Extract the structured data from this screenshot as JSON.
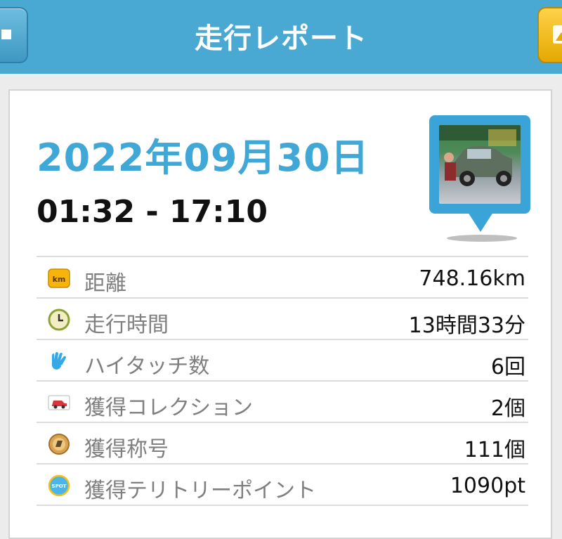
{
  "header": {
    "title": "走行レポート"
  },
  "report": {
    "date": "2022年09月30日",
    "time_range": "01:32 - 17:10"
  },
  "stats": [
    {
      "icon": "km-icon",
      "label": "距離",
      "value": "748.16km"
    },
    {
      "icon": "clock-icon",
      "label": "走行時間",
      "value": "13時間33分"
    },
    {
      "icon": "hi-hand-icon",
      "label": "ハイタッチ数",
      "value": "6回"
    },
    {
      "icon": "car-collection-icon",
      "label": "獲得コレクション",
      "value": "2個"
    },
    {
      "icon": "title-medal-icon",
      "label": "獲得称号",
      "value": "111個"
    },
    {
      "icon": "spot-icon",
      "label": "獲得テリトリーポイント",
      "value": "1090pt"
    }
  ],
  "colors": {
    "header": "#4aa9d2",
    "accent": "#3fa8d6",
    "share_button": "#f2bd18"
  }
}
